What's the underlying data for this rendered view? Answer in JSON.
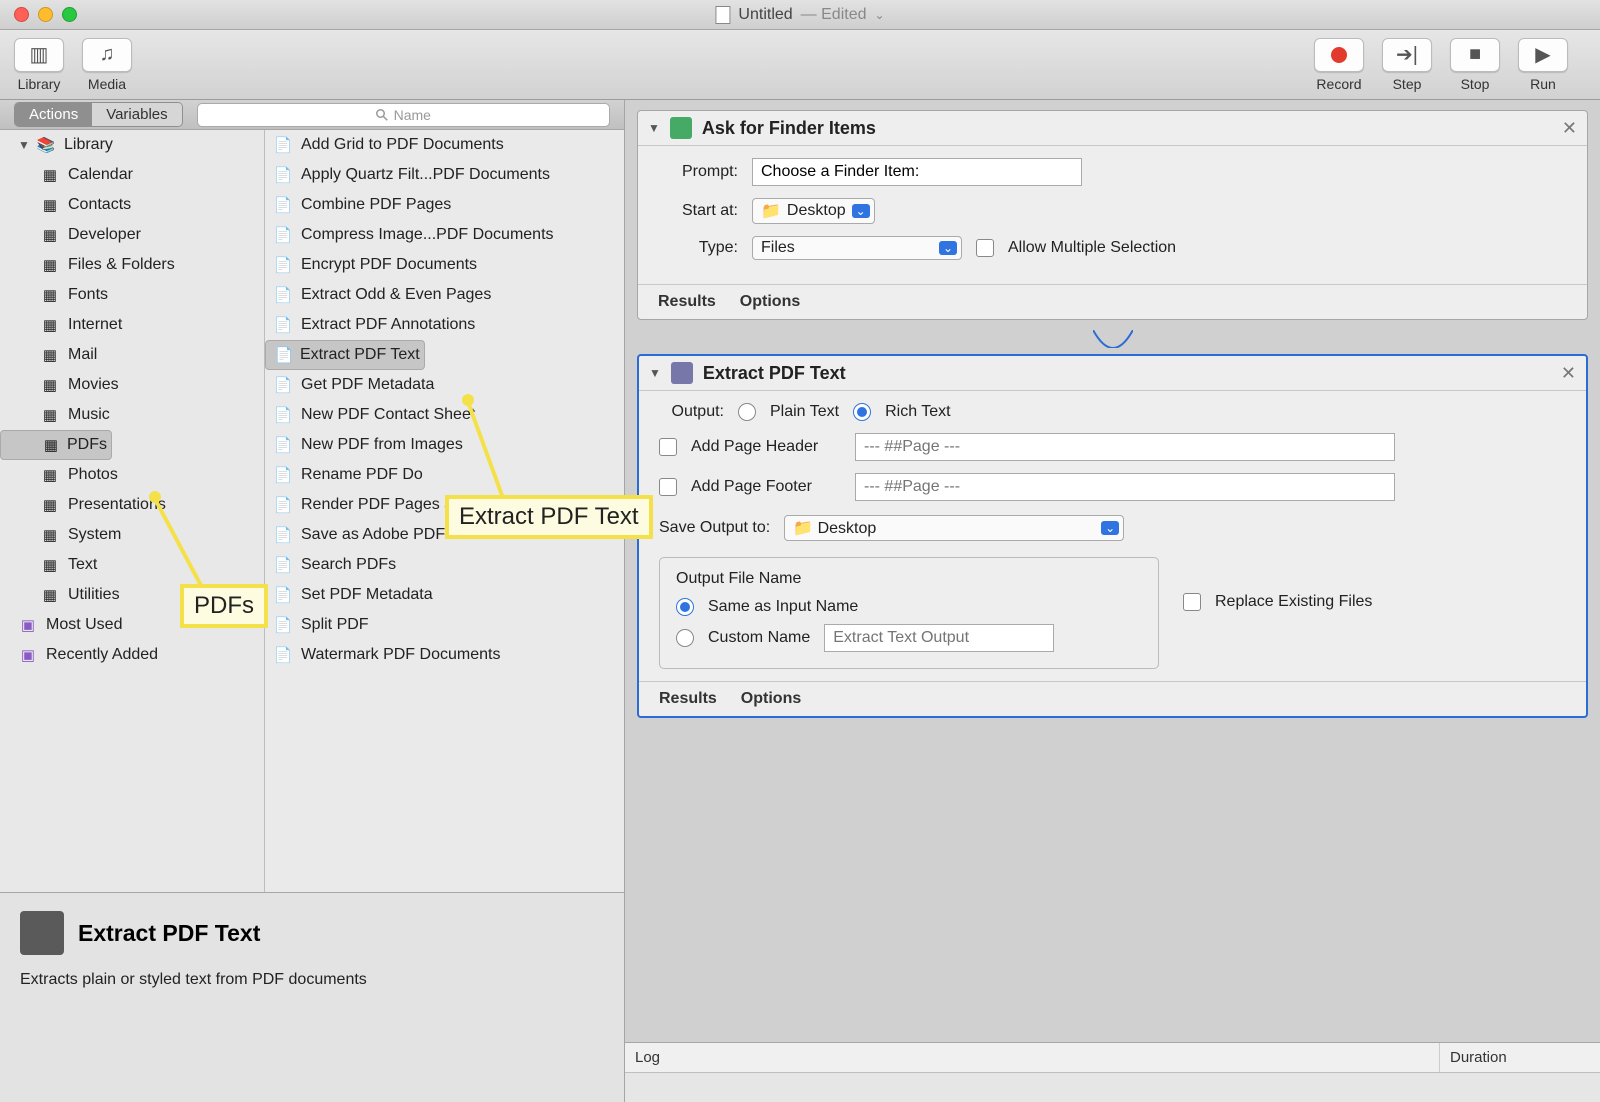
{
  "window": {
    "title": "Untitled",
    "state": "Edited"
  },
  "toolbar": {
    "library": "Library",
    "media": "Media",
    "record": "Record",
    "step": "Step",
    "stop": "Stop",
    "run": "Run"
  },
  "left": {
    "tabs": {
      "actions": "Actions",
      "variables": "Variables"
    },
    "search_placeholder": "Name",
    "library_root": "Library",
    "categories": [
      "Calendar",
      "Contacts",
      "Developer",
      "Files & Folders",
      "Fonts",
      "Internet",
      "Mail",
      "Movies",
      "Music",
      "PDFs",
      "Photos",
      "Presentations",
      "System",
      "Text",
      "Utilities"
    ],
    "selected_category": "PDFs",
    "extras": [
      "Most Used",
      "Recently Added"
    ],
    "actions": [
      "Add Grid to PDF Documents",
      "Apply Quartz Filt...PDF Documents",
      "Combine PDF Pages",
      "Compress Image...PDF Documents",
      "Encrypt PDF Documents",
      "Extract Odd & Even Pages",
      "Extract PDF Annotations",
      "Extract PDF Text",
      "Get PDF Metadata",
      "New PDF Contact Sheet",
      "New PDF from Images",
      "Rename PDF Do",
      "Render PDF Pages as Images",
      "Save as Adobe PDF",
      "Search PDFs",
      "Set PDF Metadata",
      "Split PDF",
      "Watermark PDF Documents"
    ],
    "selected_action": "Extract PDF Text"
  },
  "desc": {
    "title": "Extract PDF Text",
    "body": "Extracts plain or styled text from PDF documents"
  },
  "flow": {
    "a1": {
      "title": "Ask for Finder Items",
      "prompt_label": "Prompt:",
      "prompt_value": "Choose a Finder Item:",
      "start_label": "Start at:",
      "start_value": "Desktop",
      "type_label": "Type:",
      "type_value": "Files",
      "allow_multi": "Allow Multiple Selection",
      "results": "Results",
      "options": "Options"
    },
    "a2": {
      "title": "Extract PDF Text",
      "output_label": "Output:",
      "plain": "Plain Text",
      "rich": "Rich Text",
      "header_label": "Add Page Header",
      "header_ph": "--- ##Page ---",
      "footer_label": "Add Page Footer",
      "footer_ph": "--- ##Page ---",
      "save_label": "Save Output to:",
      "save_value": "Desktop",
      "group_title": "Output File Name",
      "same_name": "Same as Input Name",
      "custom_name": "Custom Name",
      "custom_ph": "Extract Text Output",
      "replace": "Replace Existing Files",
      "results": "Results",
      "options": "Options"
    }
  },
  "callouts": {
    "pdfs": "PDFs",
    "extract": "Extract PDF Text"
  },
  "log": {
    "col1": "Log",
    "col2": "Duration"
  }
}
